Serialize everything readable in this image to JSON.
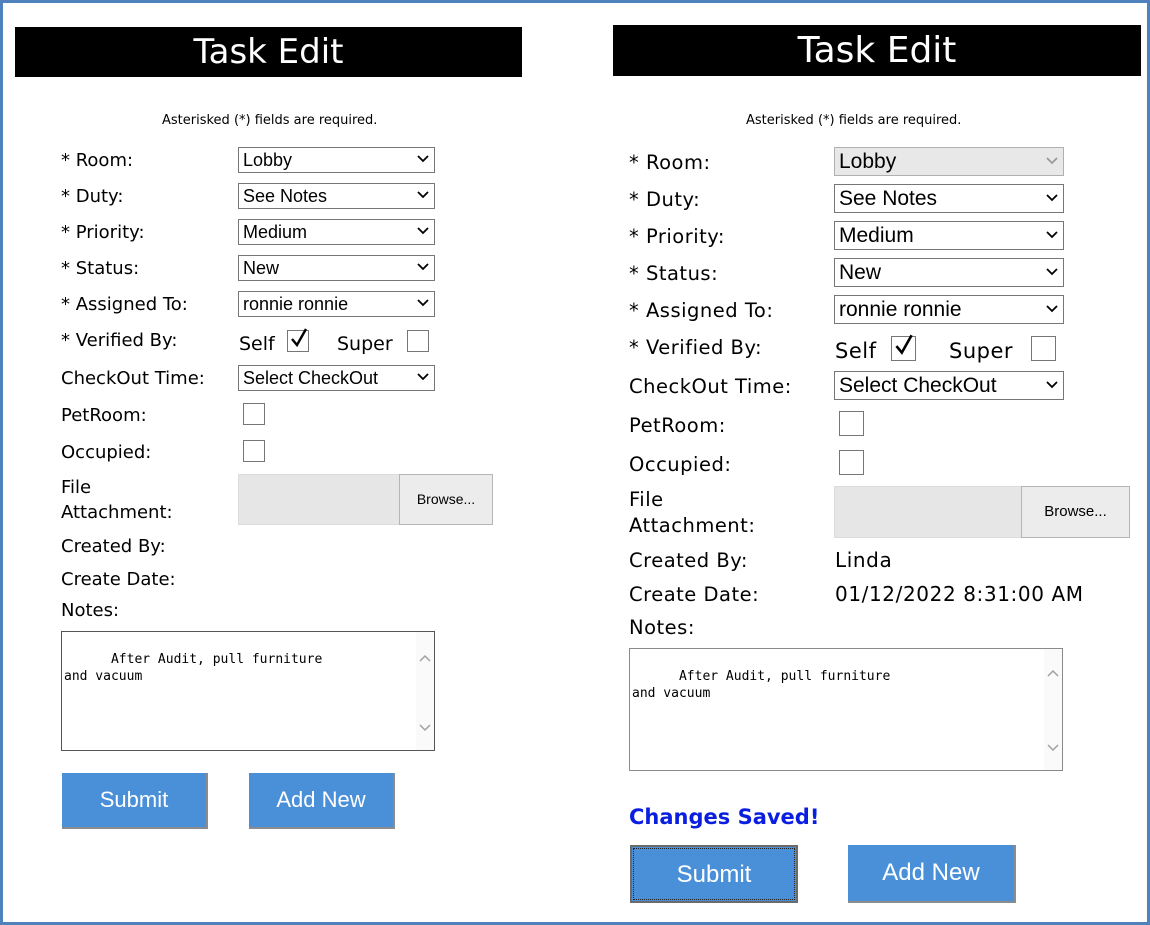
{
  "left": {
    "title": "Task Edit",
    "required_note": "Asterisked (*) fields are required.",
    "labels": {
      "room": "* Room:",
      "duty": "* Duty:",
      "priority": "* Priority:",
      "status": "* Status:",
      "assigned_to": "* Assigned To:",
      "verified_by": "* Verified By:",
      "checkout_time": "CheckOut Time:",
      "pet_room": "PetRoom:",
      "occupied": "Occupied:",
      "file_attachment_1": "File",
      "file_attachment_2": "Attachment:",
      "created_by": "Created By:",
      "create_date": "Create Date:",
      "notes": "Notes:"
    },
    "values": {
      "room": "Lobby",
      "duty": "See Notes",
      "priority": "Medium",
      "status": "New",
      "assigned_to": "ronnie ronnie",
      "checkout_time": "Select CheckOut"
    },
    "verified": {
      "self_label": "Self",
      "super_label": "Super",
      "self_checked": true,
      "super_checked": false
    },
    "pet_room_checked": false,
    "occupied_checked": false,
    "browse_label": "Browse...",
    "notes_text": "After Audit, pull furniture\nand vacuum",
    "submit_label": "Submit",
    "add_new_label": "Add New"
  },
  "right": {
    "title": "Task Edit",
    "required_note": "Asterisked (*) fields are required.",
    "labels": {
      "room": "* Room:",
      "duty": "* Duty:",
      "priority": "* Priority:",
      "status": "* Status:",
      "assigned_to": "* Assigned To:",
      "verified_by": "* Verified By:",
      "checkout_time": "CheckOut Time:",
      "pet_room": "PetRoom:",
      "occupied": "Occupied:",
      "file_attachment_1": "File",
      "file_attachment_2": "Attachment:",
      "created_by": "Created By:",
      "create_date": "Create Date:",
      "notes": "Notes:"
    },
    "values": {
      "room": "Lobby",
      "duty": "See Notes",
      "priority": "Medium",
      "status": "New",
      "assigned_to": "ronnie ronnie",
      "checkout_time": "Select CheckOut",
      "created_by": "Linda",
      "create_date": "01/12/2022 8:31:00 AM"
    },
    "room_disabled": true,
    "verified": {
      "self_label": "Self",
      "super_label": "Super",
      "self_checked": true,
      "super_checked": false
    },
    "pet_room_checked": false,
    "occupied_checked": false,
    "browse_label": "Browse...",
    "notes_text": "After Audit, pull furniture\nand vacuum",
    "status_message": "Changes Saved!",
    "submit_label": "Submit",
    "add_new_label": "Add New"
  },
  "colors": {
    "frame_border": "#4f81bd",
    "title_bg": "#000000",
    "button_bg": "#4a90d9",
    "saved_text": "#0a1ee0"
  }
}
